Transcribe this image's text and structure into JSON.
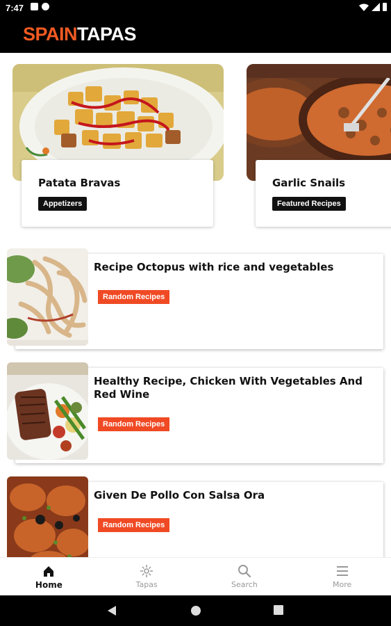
{
  "status_bar": {
    "time": "7:47"
  },
  "app_bar": {
    "logo_part1": "SPAIN",
    "logo_part2": "TAPAS"
  },
  "featured": [
    {
      "title": "Patata Bravas",
      "tag": "Appetizers"
    },
    {
      "title": "Garlic Snails",
      "tag": "Featured Recipes"
    }
  ],
  "recipes": [
    {
      "title": "Recipe Octopus with rice and vegetables",
      "tag": "Random Recipes"
    },
    {
      "title": "Healthy Recipe, Chicken With Vegetables And Red Wine",
      "tag": "Random Recipes"
    },
    {
      "title": "Given De Pollo Con Salsa Ora",
      "tag": "Random Recipes"
    }
  ],
  "bottom_nav": [
    {
      "label": "Home",
      "icon": "home-icon",
      "active": true
    },
    {
      "label": "Tapas",
      "icon": "sparkle-icon",
      "active": false
    },
    {
      "label": "Search",
      "icon": "search-icon",
      "active": false
    },
    {
      "label": "More",
      "icon": "menu-icon",
      "active": false
    }
  ],
  "colors": {
    "brand_orange": "#f05a22",
    "tag_orange": "#f04a24",
    "tag_black": "#111111"
  }
}
